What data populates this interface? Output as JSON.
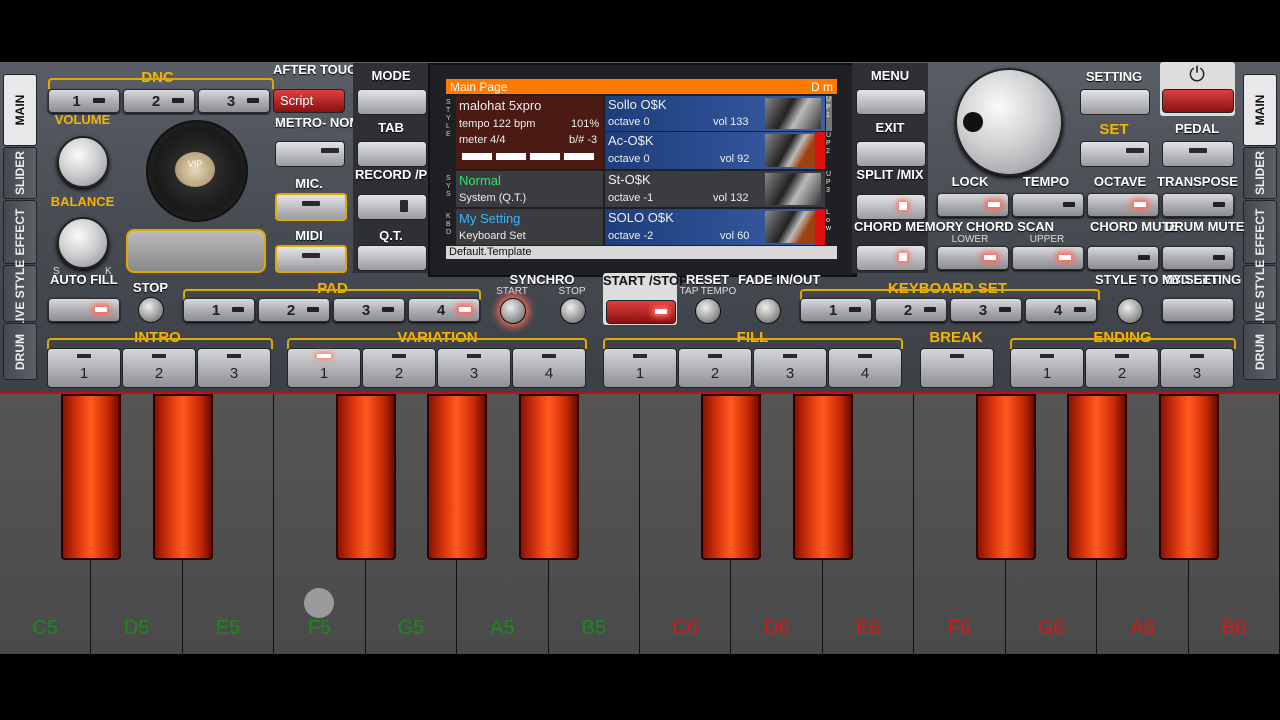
{
  "left_tabs": [
    "MAIN",
    "SLIDER",
    "EFFECT",
    "LIVE STYLE",
    "DRUM"
  ],
  "right_tabs": [
    "MAIN",
    "SLIDER",
    "EFFECT",
    "LIVE STYLE",
    "DRUM"
  ],
  "dnc": {
    "label": "DNC",
    "buttons": [
      "1",
      "2",
      "3"
    ],
    "script_label": "Script"
  },
  "after_touch": "AFTER TOUCH",
  "metronome": "METRO- NOME",
  "mic": "MIC.",
  "midi": "MIDI",
  "volume": "VOLUME",
  "balance": "BALANCE",
  "balance_s": "S",
  "balance_k": "K",
  "vip_label": "VIP",
  "mode": "MODE",
  "tab": "TAB",
  "record_play": "RECORD /PLAY",
  "qt": "Q.T.",
  "menu": "MENU",
  "exit": "EXIT",
  "split_mix": "SPLIT /MIX",
  "chord_memory": "CHORD MEMORY",
  "setting": "SETTING",
  "set": "SET",
  "pedal": "PEDAL",
  "lock": "LOCK",
  "tempo": "TEMPO",
  "octave": "OCTAVE",
  "transpose": "TRANSPOSE",
  "chord_scan": "CHORD SCAN",
  "lower": "LOWER",
  "upper": "UPPER",
  "chord_mute": "CHORD MUTE",
  "drum_mute": "DRUM MUTE",
  "auto_fill": "AUTO FILL",
  "stop": "STOP",
  "pad": {
    "label": "PAD",
    "buttons": [
      "1",
      "2",
      "3",
      "4"
    ]
  },
  "synchro": "SYNCHRO",
  "synchro_start": "START",
  "synchro_stop": "STOP",
  "start_stop": "START /STOP",
  "reset": "RESET",
  "tap_tempo": "TAP TEMPO",
  "fade": "FADE IN/OUT",
  "keyboard_set": {
    "label": "KEYBOARD SET",
    "buttons": [
      "1",
      "2",
      "3",
      "4"
    ]
  },
  "style_to_kbd": "STYLE TO KBD SET",
  "my_setting": "MY SETTING",
  "intro": {
    "label": "INTRO",
    "buttons": [
      "1",
      "2",
      "3"
    ]
  },
  "variation": {
    "label": "VARIATION",
    "buttons": [
      "1",
      "2",
      "3",
      "4"
    ]
  },
  "fill": {
    "label": "FILL",
    "buttons": [
      "1",
      "2",
      "3",
      "4"
    ]
  },
  "break_label": "BREAK",
  "ending": {
    "label": "ENDING",
    "buttons": [
      "1",
      "2",
      "3"
    ]
  },
  "display": {
    "header": "Main Page",
    "header_right": "D m",
    "style_name": "malohat 5xpro",
    "tempo": "tempo 122 bpm",
    "percent": "101%",
    "meter": "meter 4/4",
    "bsharp": "b/# -3",
    "sys_name": "Normal",
    "sys_sub": "System (Q.T.)",
    "kbd_name": "My Setting",
    "kbd_sub": "Keyboard Set",
    "footer": "Default.Template",
    "side_style": "S T Y L E",
    "side_sys": "S Y S",
    "side_kbd": "K B D",
    "voices": [
      {
        "name": "Sollo O$K",
        "octave": "octave  0",
        "vol": "vol 133",
        "tag": "U P 1"
      },
      {
        "name": "Ac-O$K",
        "octave": "octave  0",
        "vol": "vol 92",
        "tag": "U P 2"
      },
      {
        "name": "St-O$K",
        "octave": "octave -1",
        "vol": "vol 132",
        "tag": "U P 3"
      },
      {
        "name": "SOLO O$K",
        "octave": "octave -2",
        "vol": "vol 60",
        "tag": "L o w"
      }
    ]
  },
  "keys": [
    "C5",
    "D5",
    "E5",
    "F5",
    "G5",
    "A5",
    "B5",
    "C6",
    "D6",
    "E6",
    "F6",
    "G6",
    "A6",
    "B6"
  ],
  "colors": {
    "green_note": "#1a8a1a",
    "red_note": "#d81818",
    "accent": "#f5b400",
    "display_orange": "#ff7a00"
  }
}
